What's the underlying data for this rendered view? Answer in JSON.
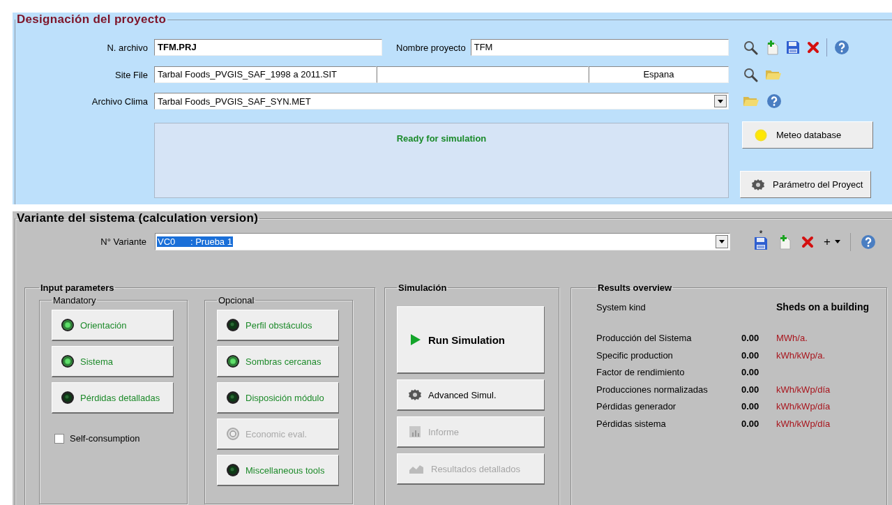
{
  "project_panel": {
    "title": "Designación del proyecto",
    "file_name": {
      "label": "N. archivo",
      "value": "TFM.PRJ"
    },
    "project_name": {
      "label": "Nombre proyecto",
      "value": "TFM"
    },
    "site_file": {
      "label": "Site File",
      "file": "Tarbal Foods_PVGIS_SAF_1998 a 2011.SIT",
      "country": "Espana"
    },
    "weather_file": {
      "label": "Archivo Clima",
      "value": "Tarbal Foods_PVGIS_SAF_SYN.MET"
    },
    "status": "Ready for simulation",
    "buttons": [
      {
        "label": "Meteo database",
        "kind": "meteo"
      },
      {
        "label": "Parámetro del Proyect",
        "kind": "settings"
      }
    ]
  },
  "variant_panel": {
    "title": "Variante del sistema (calculation version)",
    "variant": {
      "label": "N° Variante",
      "value": "VC0      : Prueba 1",
      "selected": true
    },
    "modified_mark": "*",
    "add_menu": "+",
    "input_parameters": {
      "title": "Input parameters",
      "mandatory": {
        "title": "Mandatory",
        "buttons": [
          {
            "label": "Orientación",
            "lit": true,
            "disabled": false
          },
          {
            "label": "Sistema",
            "lit": true,
            "disabled": false
          },
          {
            "label": "Pérdidas detalladas",
            "lit": false,
            "disabled": false
          }
        ]
      },
      "self_consumption": {
        "label": "Self-consumption",
        "checked": false
      },
      "optional": {
        "title": "Opcional",
        "buttons": [
          {
            "label": "Perfil obstáculos",
            "lit": false,
            "disabled": false
          },
          {
            "label": "Sombras cercanas",
            "lit": true,
            "disabled": false
          },
          {
            "label": "Disposición módulo",
            "lit": false,
            "disabled": false
          },
          {
            "label": "Economic eval.",
            "lit": false,
            "disabled": true
          },
          {
            "label": "Miscellaneous tools",
            "lit": false,
            "disabled": false
          }
        ]
      }
    },
    "simulation": {
      "title": "Simulación",
      "buttons": [
        {
          "label": "Run Simulation",
          "kind": "run",
          "disabled": false
        },
        {
          "label": "Advanced Simul.",
          "kind": "advanced",
          "disabled": false
        },
        {
          "label": "Informe",
          "kind": "report",
          "disabled": true
        },
        {
          "label": "Resultados detallados",
          "kind": "results",
          "disabled": true
        }
      ]
    },
    "results": {
      "title": "Results overview",
      "system_kind": {
        "label": "System kind",
        "value": "Sheds on a building"
      },
      "rows": [
        {
          "label": "Producción del Sistema",
          "value": "0.00",
          "unit": "MWh/a."
        },
        {
          "label": "Specific production",
          "value": "0.00",
          "unit": "kWh/kWp/a."
        },
        {
          "label": "Factor de rendimiento",
          "value": "0.00"
        },
        {
          "label": "Producciones normalizadas",
          "value": "0.00",
          "unit": "kWh/kWp/día"
        },
        {
          "label": "Pérdidas generador",
          "value": "0.00",
          "unit": "kWh/kWp/día"
        },
        {
          "label": "Pérdidas sistema",
          "value": "0.00",
          "unit": "kWh/kWp/día"
        }
      ]
    }
  }
}
